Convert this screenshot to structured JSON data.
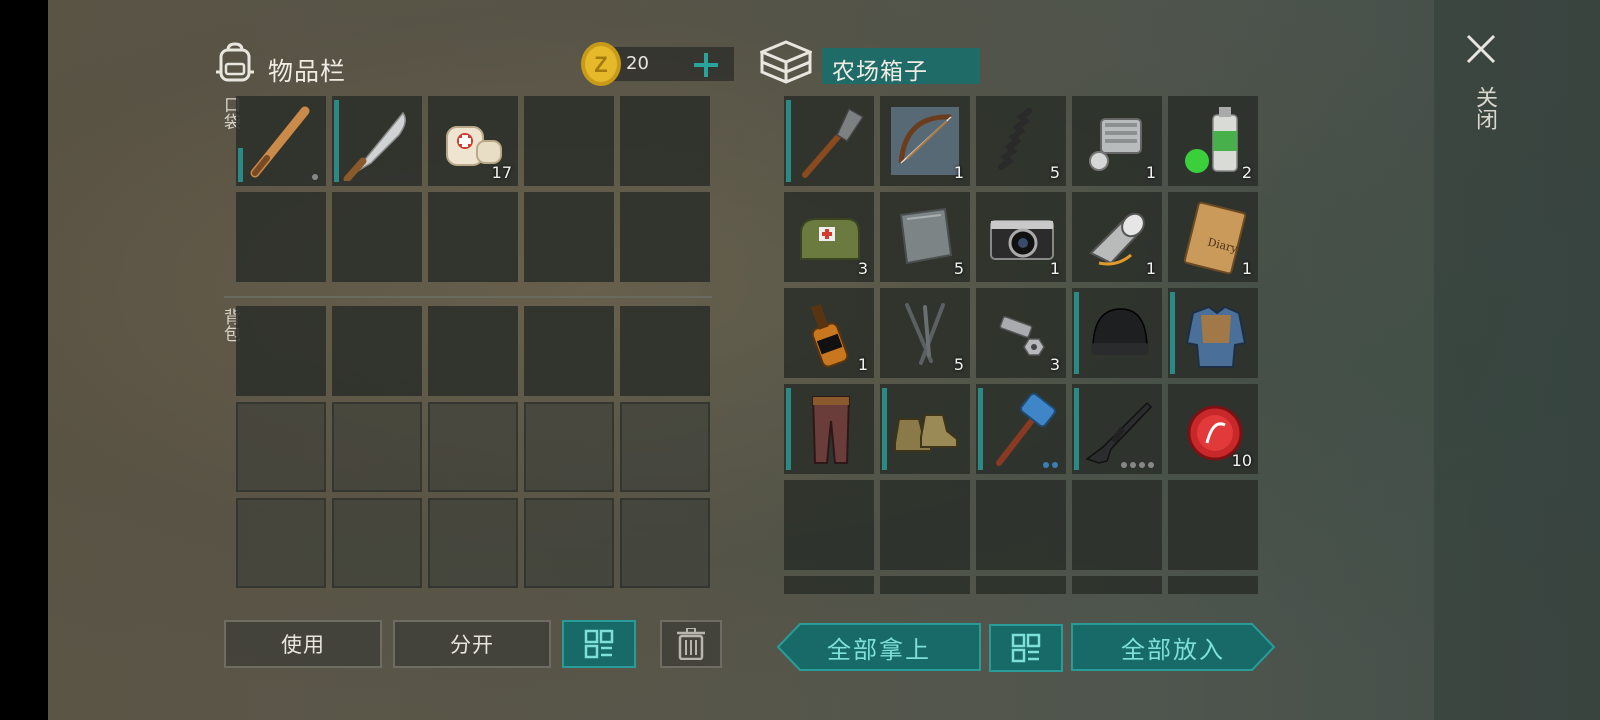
{
  "inventory": {
    "title": "物品栏",
    "coins": "20",
    "pocket_label": "口袋",
    "backpack_label": "背包",
    "pocket_slots": [
      {
        "item": "baseball-bat",
        "count": "",
        "dots": [
          0,
          1
        ]
      },
      {
        "item": "machete",
        "count": "",
        "dots": [
          0,
          0,
          0
        ]
      },
      {
        "item": "bandage",
        "count": "17"
      },
      {},
      {},
      {},
      {},
      {},
      {},
      {}
    ]
  },
  "container": {
    "title": "农场箱子",
    "slots": [
      {
        "item": "shovel",
        "count": ""
      },
      {
        "item": "bow",
        "count": "1"
      },
      {
        "item": "spring",
        "count": "5"
      },
      {
        "item": "engine-part",
        "count": "1"
      },
      {
        "item": "spray-paint",
        "count": "2"
      },
      {
        "item": "first-aid-bag",
        "count": "3"
      },
      {
        "item": "metal-plate",
        "count": "5"
      },
      {
        "item": "camera",
        "count": "1"
      },
      {
        "item": "flashlight",
        "count": "1"
      },
      {
        "item": "diary",
        "count": "1"
      },
      {
        "item": "whiskey",
        "count": "1"
      },
      {
        "item": "nails",
        "count": "5"
      },
      {
        "item": "bolts",
        "count": "3"
      },
      {
        "item": "beanie",
        "count": ""
      },
      {
        "item": "jacket",
        "count": ""
      },
      {
        "item": "pants",
        "count": ""
      },
      {
        "item": "boots",
        "count": ""
      },
      {
        "item": "sledgehammer",
        "count": ""
      },
      {
        "item": "assault-rifle",
        "count": ""
      },
      {
        "item": "bottle-cap",
        "count": "10"
      }
    ]
  },
  "buttons": {
    "use": "使用",
    "split": "分开",
    "take_all": "全部拿上",
    "put_all": "全部放入"
  },
  "close_label": "关闭",
  "colors": {
    "accent": "#2c8a86",
    "button_teal": "#176a68",
    "text_teal": "#7fe0d8"
  }
}
